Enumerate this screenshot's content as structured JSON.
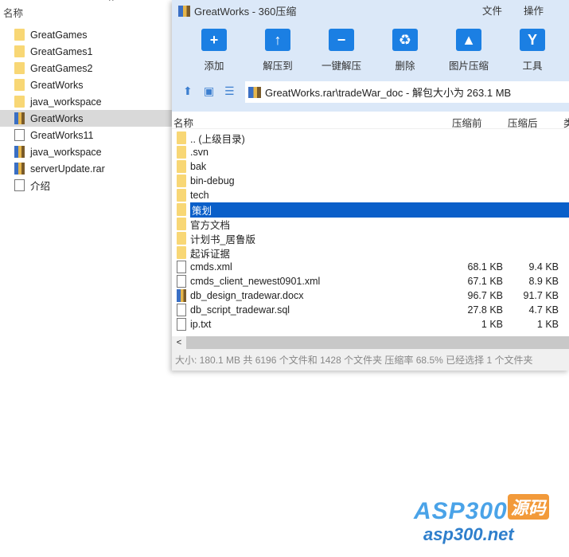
{
  "left": {
    "header": "名称",
    "items": [
      {
        "label": "GreatGames",
        "icon": "folder"
      },
      {
        "label": "GreatGames1",
        "icon": "folder"
      },
      {
        "label": "GreatGames2",
        "icon": "folder"
      },
      {
        "label": "GreatWorks",
        "icon": "folder"
      },
      {
        "label": "java_workspace",
        "icon": "folder"
      },
      {
        "label": "GreatWorks",
        "icon": "rar",
        "selected": true
      },
      {
        "label": "GreatWorks11",
        "icon": "file"
      },
      {
        "label": "java_workspace",
        "icon": "rar"
      },
      {
        "label": "serverUpdate.rar",
        "icon": "rar-exe"
      },
      {
        "label": "介绍",
        "icon": "text"
      }
    ]
  },
  "window": {
    "title": "GreatWorks - 360压缩",
    "menu": [
      "文件",
      "操作"
    ],
    "toolbar": [
      {
        "label": "添加",
        "icon": "+"
      },
      {
        "label": "解压到",
        "icon": "↑"
      },
      {
        "label": "一键解压",
        "icon": "−"
      },
      {
        "label": "删除",
        "icon": "♻"
      },
      {
        "label": "图片压缩",
        "icon": "▲"
      },
      {
        "label": "工具",
        "icon": "Y"
      }
    ],
    "address": "GreatWorks.rar\\tradeWar_doc - 解包大小为 263.1 MB",
    "columns": {
      "name": "名称",
      "before": "压缩前",
      "after": "压缩后",
      "type": "类"
    },
    "rows": [
      {
        "name": ".. (上级目录)",
        "icon": "folder",
        "before": "",
        "after": ""
      },
      {
        "name": ".svn",
        "icon": "folder",
        "before": "",
        "after": ""
      },
      {
        "name": "bak",
        "icon": "folder",
        "before": "",
        "after": ""
      },
      {
        "name": "bin-debug",
        "icon": "folder",
        "before": "",
        "after": ""
      },
      {
        "name": "tech",
        "icon": "folder",
        "before": "",
        "after": ""
      },
      {
        "name": "策划",
        "icon": "folder",
        "before": "",
        "after": "",
        "selected": true
      },
      {
        "name": "官方文档",
        "icon": "folder",
        "before": "",
        "after": ""
      },
      {
        "name": "计划书_居鲁版",
        "icon": "folder",
        "before": "",
        "after": ""
      },
      {
        "name": "起诉证据",
        "icon": "folder",
        "before": "",
        "after": ""
      },
      {
        "name": "cmds.xml",
        "icon": "xml",
        "before": "68.1 KB",
        "after": "9.4 KB"
      },
      {
        "name": "cmds_client_newest0901.xml",
        "icon": "xml",
        "before": "67.1 KB",
        "after": "8.9 KB"
      },
      {
        "name": "db_design_tradewar.docx",
        "icon": "docx",
        "before": "96.7 KB",
        "after": "91.7 KB"
      },
      {
        "name": "db_script_tradewar.sql",
        "icon": "file",
        "before": "27.8 KB",
        "after": "4.7 KB"
      },
      {
        "name": "ip.txt",
        "icon": "text",
        "before": "1 KB",
        "after": "1 KB"
      }
    ],
    "status": "大小: 180.1 MB 共 6196 个文件和 1428 个文件夹 压缩率 68.5% 已经选择 1 个文件夹"
  },
  "watermark": {
    "brand": "ASP300",
    "badge": "源码",
    "url": "asp300.net"
  },
  "colors": {
    "selection": "#0a5fc9",
    "toolbar_bg": "#dbe8f8",
    "icon_blue": "#1b7fe3"
  }
}
